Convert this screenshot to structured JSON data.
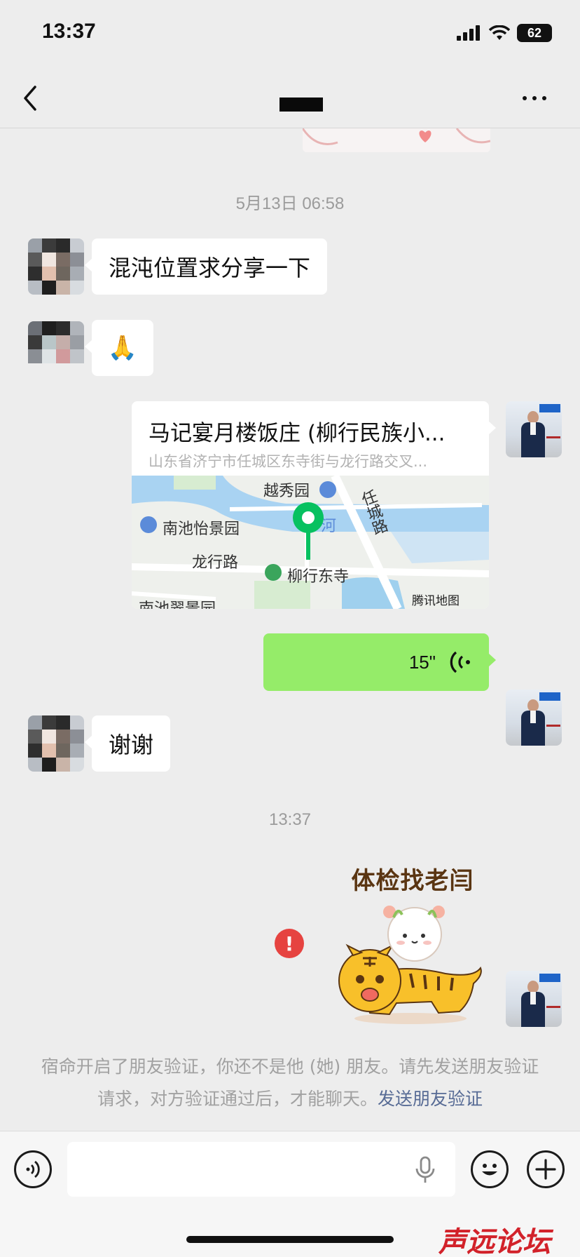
{
  "status_bar": {
    "time": "13:37",
    "battery": "62",
    "icons": [
      "signal-icon",
      "wifi-icon",
      "battery-icon"
    ]
  },
  "nav": {
    "back_icon": "chevron-left-icon",
    "more_icon": "more-dots-icon"
  },
  "messages": {
    "timestamp_1": "5月13日 06:58",
    "incoming_1": "混沌位置求分享一下",
    "incoming_2_emoji": "🙏",
    "location": {
      "title": "马记宴月楼饭庄 (柳行民族小...",
      "address": "山东省济宁市任城区东寺街与龙行路交叉...",
      "map": {
        "labels": [
          "越秀园",
          "南池怡景园",
          "任城路",
          "河",
          "龙行路",
          "柳行东寺",
          "南池翠景园"
        ],
        "provider": "腾讯地图"
      }
    },
    "voice_duration": "15\"",
    "incoming_3": "谢谢",
    "timestamp_2": "13:37",
    "sticker_caption": "体检找老闫",
    "fail_mark": "!"
  },
  "notice": {
    "text": "宿命开启了朋友验证，你还不是他 (她) 朋友。请先发送朋友验证请求，对方验证通过后，才能聊天。",
    "link": "发送朋友验证"
  },
  "input_bar": {
    "voice_icon": "voice-mode-icon",
    "mic_icon": "microphone-icon",
    "emoji_icon": "emoji-icon",
    "plus_icon": "plus-icon"
  },
  "watermark": "声远论坛",
  "colors": {
    "background": "#ededed",
    "out_bubble": "#95ec69",
    "in_bubble": "#ffffff",
    "link": "#576b95",
    "error": "#e64340"
  }
}
